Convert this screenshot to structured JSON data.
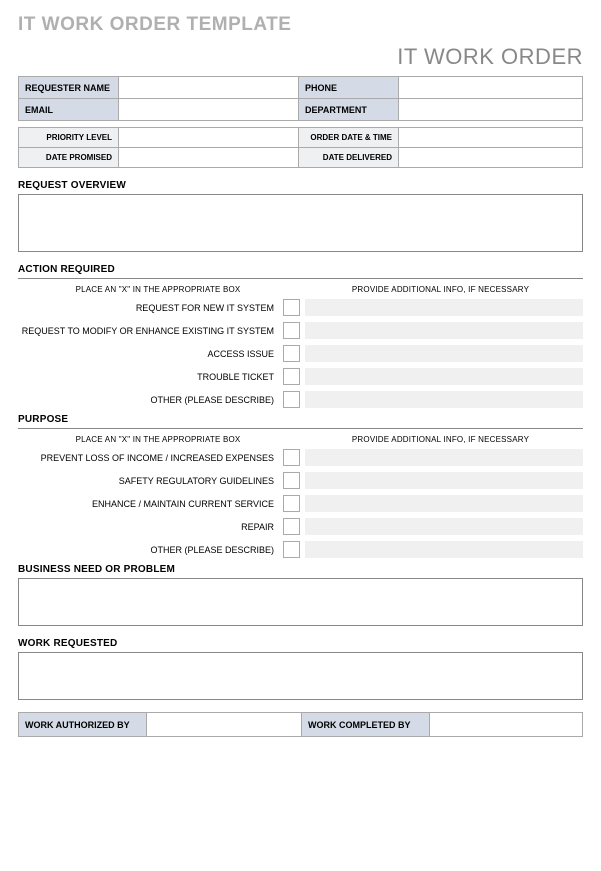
{
  "mainTitle": "IT WORK ORDER TEMPLATE",
  "subTitle": "IT WORK ORDER",
  "requester": {
    "nameLabel": "REQUESTER NAME",
    "phoneLabel": "PHONE",
    "emailLabel": "EMAIL",
    "departmentLabel": "DEPARTMENT"
  },
  "meta": {
    "priorityLabel": "PRIORITY LEVEL",
    "orderDateLabel": "ORDER DATE & TIME",
    "datePromisedLabel": "DATE PROMISED",
    "dateDeliveredLabel": "DATE DELIVERED"
  },
  "sections": {
    "requestOverview": "REQUEST OVERVIEW",
    "actionRequired": "ACTION REQUIRED",
    "purpose": "PURPOSE",
    "businessNeed": "BUSINESS NEED OR PROBLEM",
    "workRequested": "WORK REQUESTED"
  },
  "hints": {
    "placeX": "PLACE AN \"X\" IN THE APPROPRIATE BOX",
    "additionalInfo": "PROVIDE ADDITIONAL INFO, IF NECESSARY"
  },
  "actionItems": {
    "item0": "REQUEST FOR NEW IT SYSTEM",
    "item1": "REQUEST TO MODIFY OR ENHANCE EXISTING IT SYSTEM",
    "item2": "ACCESS ISSUE",
    "item3": "TROUBLE TICKET",
    "item4": "OTHER (PLEASE DESCRIBE)"
  },
  "purposeItems": {
    "item0": "PREVENT LOSS OF INCOME / INCREASED EXPENSES",
    "item1": "SAFETY REGULATORY GUIDELINES",
    "item2": "ENHANCE / MAINTAIN CURRENT SERVICE",
    "item3": "REPAIR",
    "item4": "OTHER (PLEASE DESCRIBE)"
  },
  "footer": {
    "authorizedLabel": "WORK AUTHORIZED BY",
    "completedLabel": "WORK COMPLETED BY"
  }
}
